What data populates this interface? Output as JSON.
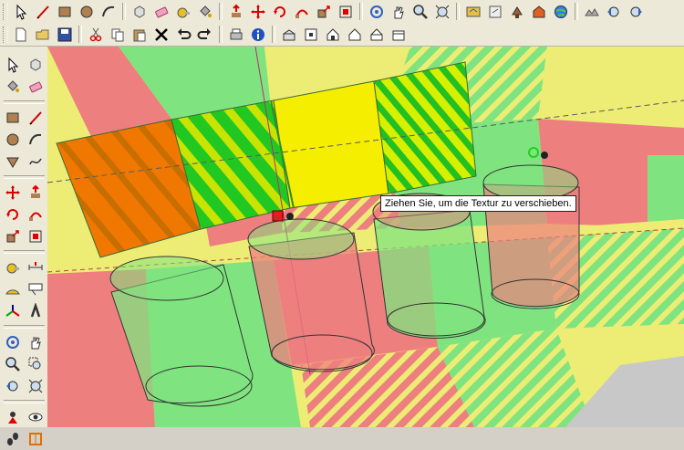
{
  "toolbar_top": {
    "groups": [
      [
        "select-arrow-icon",
        "pencil-line-icon",
        "rectangle-icon",
        "circle-icon",
        "arc-icon"
      ],
      [
        "make-component-icon",
        "eraser-icon",
        "tape-measure-icon",
        "paint-bucket-icon"
      ],
      [
        "push-pull-icon",
        "move-icon",
        "rotate-icon",
        "follow-me-icon",
        "scale-icon",
        "offset-icon"
      ],
      [
        "orbit-icon",
        "pan-hand-icon",
        "zoom-icon",
        "zoom-extents-icon"
      ],
      [
        "get-models-icon",
        "share-model-icon",
        "share-component-icon",
        "3d-warehouse-icon",
        "google-earth-icon"
      ],
      [
        "toggle-terrain-icon",
        "previous-view-icon",
        "next-view-icon"
      ]
    ]
  },
  "toolbar_second": {
    "groups": [
      [
        "new-file-icon",
        "open-folder-icon",
        "save-disk-icon"
      ],
      [
        "cut-icon",
        "copy-icon",
        "paste-icon",
        "delete-x-icon",
        "undo-icon",
        "redo-icon"
      ],
      [
        "print-icon",
        "model-info-icon"
      ],
      [
        "iso-view-icon",
        "top-view-icon",
        "front-view-icon",
        "right-view-icon",
        "back-view-icon",
        "left-view-icon"
      ]
    ]
  },
  "sidebar_tools": [
    [
      "select-arrow-icon",
      "make-component-icon"
    ],
    [
      "paint-bucket-icon",
      "eraser-icon"
    ],
    "sep",
    [
      "rectangle-icon",
      "pencil-line-icon"
    ],
    [
      "circle-icon",
      "arc-icon"
    ],
    [
      "polygon-icon",
      "freehand-icon"
    ],
    "sep",
    [
      "move-icon",
      "push-pull-icon"
    ],
    [
      "rotate-icon",
      "follow-me-icon"
    ],
    [
      "scale-icon",
      "offset-icon"
    ],
    "sep",
    [
      "tape-measure-icon",
      "dimension-icon"
    ],
    [
      "protractor-icon",
      "text-label-icon"
    ],
    [
      "axes-icon",
      "3d-text-icon"
    ],
    "sep",
    [
      "orbit-icon",
      "pan-hand-icon"
    ],
    [
      "zoom-icon",
      "zoom-window-icon"
    ],
    [
      "previous-view-icon",
      "zoom-extents-icon"
    ],
    "sep",
    [
      "position-camera-icon",
      "look-around-icon"
    ],
    [
      "walk-icon",
      "section-plane-icon"
    ]
  ],
  "viewport": {
    "tooltip_text": "Ziehen Sie, um die Textur zu verschieben.",
    "colors": {
      "red": "#ee7f7f",
      "green": "#7fe47f",
      "yellow": "#eded75",
      "orange": "#f07800",
      "bright_green": "#22d022",
      "bright_yellow": "#f5ee00"
    }
  }
}
